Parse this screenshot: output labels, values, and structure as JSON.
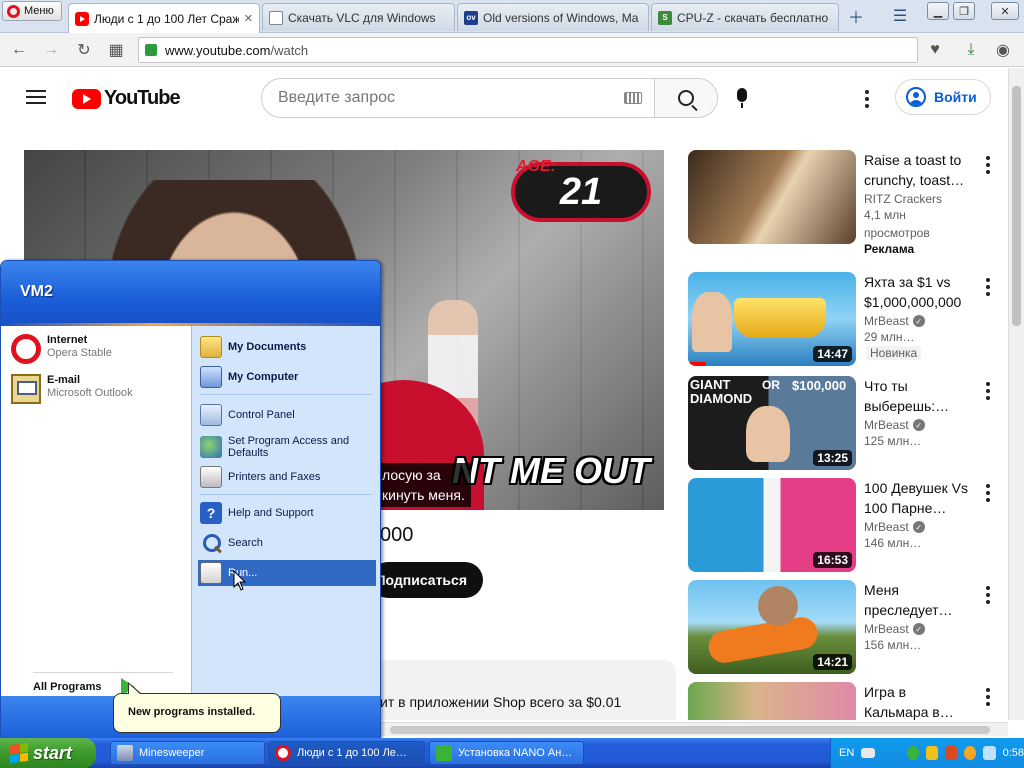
{
  "browser": {
    "menu_label": "Меню",
    "tabs": [
      {
        "title": "Люди с 1 до 100 Лет Сража",
        "icon": "youtube-favicon",
        "active": true
      },
      {
        "title": "Скачать VLC для Windows",
        "icon": "page-favicon",
        "active": false
      },
      {
        "title": "Old versions of Windows, Ma",
        "icon": "ov-favicon",
        "active": false
      },
      {
        "title": "CPU-Z - скачать бесплатно",
        "icon": "s-favicon",
        "active": false
      }
    ],
    "address": {
      "host": "www.youtube.com",
      "path": "/watch"
    }
  },
  "youtube": {
    "logo_text": "YouTube",
    "search_placeholder": "Введите запрос",
    "signin_label": "Войти",
    "player": {
      "age_label": "AGE:",
      "age_value": "21",
      "thumb_caption": "NT ME OUT",
      "subtitle_line1": "лосую за",
      "subtitle_line2": "кинуть меня."
    },
    "title_fragment": "000",
    "subscribe_label": "Подписаться",
    "promo_text": "ит в приложении Shop всего за $0.01",
    "recommendations": [
      {
        "title": "Raise a toast to crunchy, toast…",
        "channel": "RITZ Crackers",
        "verified": false,
        "meta_lines": [
          "4,1 млн",
          "просмотров"
        ],
        "badge": "Реклама",
        "duration": ""
      },
      {
        "title": "Яхта за $1 vs $1,000,000,000",
        "channel": "MrBeast",
        "verified": true,
        "meta_lines": [
          "29 млн…"
        ],
        "badge": "Новинка",
        "duration": "14:47"
      },
      {
        "title": "Что ты выберешь:…",
        "channel": "MrBeast",
        "verified": true,
        "meta_lines": [
          "125 млн…"
        ],
        "badge": "",
        "duration": "13:25",
        "thumb_text_left": "GIANT DIAMOND",
        "thumb_text_mid": "OR",
        "thumb_text_right": "$100,000"
      },
      {
        "title": "100 Девушек Vs 100 Парне…",
        "channel": "MrBeast",
        "verified": true,
        "meta_lines": [
          "146 млн…"
        ],
        "badge": "",
        "duration": "16:53"
      },
      {
        "title": "Меня преследует…",
        "channel": "MrBeast",
        "verified": true,
        "meta_lines": [
          "156 млн…"
        ],
        "badge": "",
        "duration": "14:21"
      },
      {
        "title": "Игра в Кальмара в…",
        "channel": "",
        "verified": false,
        "meta_lines": [],
        "badge": "",
        "duration": ""
      }
    ]
  },
  "start_menu": {
    "user": "VM2",
    "pinned": [
      {
        "name": "Internet",
        "sub": "Opera Stable",
        "icon": "opera-icon"
      },
      {
        "name": "E-mail",
        "sub": "Microsoft Outlook",
        "icon": "outlook-icon"
      }
    ],
    "all_programs": "All Programs",
    "right_items": [
      {
        "label": "My Documents",
        "bold": true,
        "icon": "folder-icon"
      },
      {
        "label": "My Computer",
        "bold": true,
        "icon": "computer-icon"
      },
      {
        "label": "Control Panel",
        "bold": false,
        "icon": "control-panel-icon"
      },
      {
        "label": "Set Program Access and Defaults",
        "bold": false,
        "icon": "globe-icon"
      },
      {
        "label": "Printers and Faxes",
        "bold": false,
        "icon": "printer-icon"
      },
      {
        "label": "Help and Support",
        "bold": false,
        "icon": "help-icon"
      },
      {
        "label": "Search",
        "bold": false,
        "icon": "search-icon"
      },
      {
        "label": "Run...",
        "bold": false,
        "icon": "run-icon",
        "highlighted": true
      }
    ],
    "balloon": "New programs installed."
  },
  "taskbar": {
    "start_label": "start",
    "tasks": [
      {
        "label": "Minesweeper",
        "icon": "minesweeper-icon"
      },
      {
        "label": "Люди с 1 до 100 Ле…",
        "icon": "opera-icon"
      },
      {
        "label": "Установка NANO Ан…",
        "icon": "installer-icon"
      }
    ],
    "language": "EN",
    "clock": "0:58"
  },
  "colors": {
    "youtube_red": "#ff0000",
    "xp_blue": "#245edb",
    "xp_green": "#3c9a2b",
    "link_blue": "#065fd4",
    "highlight": "#316ac5"
  }
}
